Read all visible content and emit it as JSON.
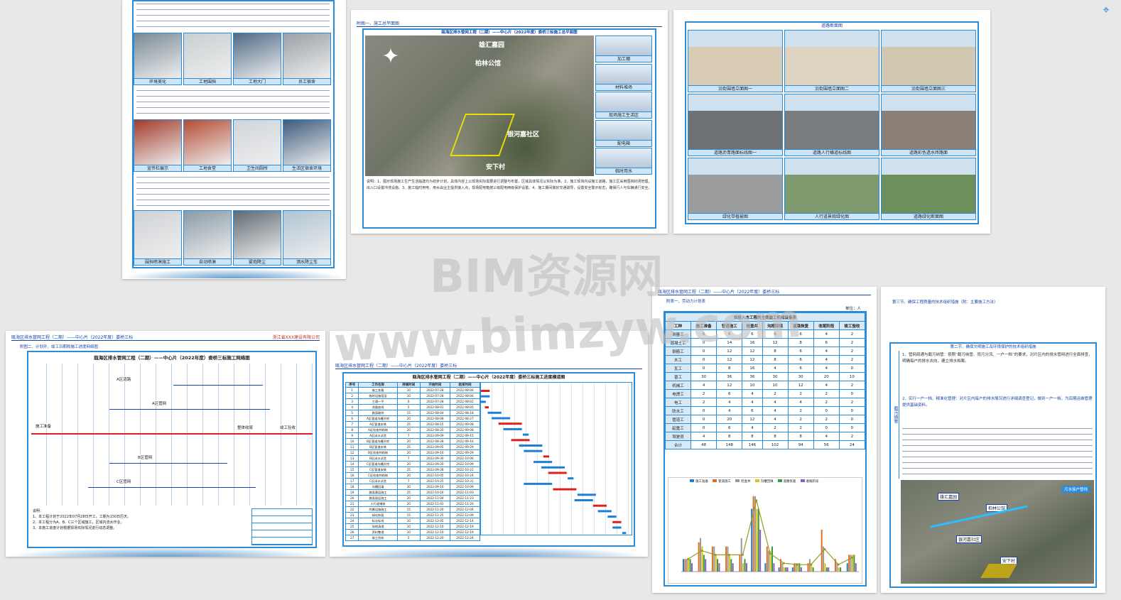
{
  "watermarks": [
    "BIM资源网",
    "www.bimzyw.com"
  ],
  "page1": {
    "photo_captions_row1": [
      "环境美化",
      "工地围挡",
      "工地大门",
      "员工宿舍"
    ],
    "photo_captions_row2": [
      "宣传栏展示",
      "工地食堂",
      "卫生间厕所",
      "生活区宿舍环境"
    ],
    "photo_captions_row3": [
      "围挡喷淋施工",
      "自动喷淋",
      "雾炮降尘",
      "洒水降尘车"
    ]
  },
  "page2": {
    "header": "附图一、施工总平面图",
    "title": "瓯海区排水管网工程（二期）——中心片（2022年度）娄桥三标施工总平面图",
    "map_labels": [
      "雄汇嘉园",
      "柏林公馆",
      "银河嘉社区",
      "安下村"
    ],
    "side_captions": [
      "加工棚",
      "材料堆场",
      "现场施工生活区",
      "配电箱",
      "临时用水"
    ],
    "note": "说明：1、图示现场施工生产生活临建均为初步计划，具体内容上以现场实际需要进行调整与布置，区域具体情况以实际为准。2、施工现场内设施工道路，施工区采用围挡封闭管理，出入口设置冲洗设施。3、施工临时用电、用水由业主提供接入点，现场配电箱按三级配电两级保护设置。4、施工期间做好交通疏导，设置安全警示标志，确保行人与车辆通行安全。"
  },
  "page3": {
    "title": "道路断面图",
    "captions_row1": [
      "沿街围墙立面图一",
      "沿街围墙立面图二",
      "沿街围墙立面图三"
    ],
    "captions_row2": [
      "道路沥青路面标线图一",
      "道路人行横道标线图",
      "道路彩色透水砖路面"
    ],
    "captions_row3": [
      "绿化带植被图",
      "人行道景观绿化图",
      "道路绿化断面图"
    ]
  },
  "page4": {
    "header_left": "瓯海区排水管网工程（二期）——中心片（2022年度）娄桥三标",
    "company": "浙江省XXX建设有限公司",
    "section": "附图二、计划开、竣工日期和施工进度网络图",
    "title": "瓯海区排水管网工程（二期）——中心片（2022年度）娄桥三标施工网络图",
    "labels": [
      "施工准备",
      "A区道路",
      "A区管网",
      "B区管网",
      "C区管网",
      "整体收尾",
      "竣工验收"
    ],
    "notes": [
      "说明：",
      "1、本工程计划于2022年07月28日开工，工期为150日历天。",
      "2、本工程分为A、B、C三个区域施工，区域内流水作业。",
      "3、本施工进度计划根据现场实际情况进行动态调整。"
    ]
  },
  "page5": {
    "header": "瓯海区排水管网工程（二期）——中心片（2022年度）娄桥三标",
    "title": "瓯海区排水管网工程（二期）——中心片（2022年度）娄桥三标施工进度横道图",
    "columns": [
      "序号",
      "工作名称",
      "持续时间",
      "开始时间",
      "结束时间"
    ],
    "rows": [
      [
        "1",
        "施工准备",
        "10",
        "2022-07-28",
        "2022-08-06"
      ],
      [
        "2",
        "临时设施搭设",
        "10",
        "2022-07-28",
        "2022-08-06"
      ],
      [
        "3",
        "三通一平",
        "6",
        "2022-07-28",
        "2022-08-02"
      ],
      [
        "4",
        "测量放线",
        "5",
        "2022-08-01",
        "2022-08-05"
      ],
      [
        "5",
        "路面破除",
        "15",
        "2022-08-04",
        "2022-08-18"
      ],
      [
        "6",
        "A区管道沟槽开挖",
        "20",
        "2022-08-08",
        "2022-08-27"
      ],
      [
        "7",
        "A区管道安装",
        "25",
        "2022-08-15",
        "2022-09-08"
      ],
      [
        "8",
        "A区检查井砌筑",
        "20",
        "2022-08-20",
        "2022-09-08"
      ],
      [
        "9",
        "A区闭水试验",
        "7",
        "2022-09-09",
        "2022-09-15"
      ],
      [
        "10",
        "B区管道沟槽开挖",
        "20",
        "2022-08-28",
        "2022-09-16"
      ],
      [
        "11",
        "B区管道安装",
        "25",
        "2022-09-05",
        "2022-09-29"
      ],
      [
        "12",
        "B区检查井砌筑",
        "20",
        "2022-09-10",
        "2022-09-29"
      ],
      [
        "13",
        "B区闭水试验",
        "7",
        "2022-09-30",
        "2022-10-06"
      ],
      [
        "14",
        "C区管道沟槽开挖",
        "20",
        "2022-09-20",
        "2022-10-09"
      ],
      [
        "15",
        "C区管道安装",
        "25",
        "2022-09-28",
        "2022-10-22"
      ],
      [
        "16",
        "C区检查井砌筑",
        "20",
        "2022-10-05",
        "2022-10-24"
      ],
      [
        "17",
        "C区闭水试验",
        "7",
        "2022-10-25",
        "2022-10-31"
      ],
      [
        "18",
        "沟槽回填",
        "30",
        "2022-09-10",
        "2022-10-09"
      ],
      [
        "19",
        "路面基层施工",
        "25",
        "2022-10-10",
        "2022-11-03"
      ],
      [
        "20",
        "路面面层施工",
        "20",
        "2022-11-04",
        "2022-11-23"
      ],
      [
        "21",
        "人行道铺装",
        "20",
        "2022-11-01",
        "2022-11-20"
      ],
      [
        "22",
        "附属设施施工",
        "15",
        "2022-11-20",
        "2022-12-04"
      ],
      [
        "23",
        "绿化恢复",
        "15",
        "2022-11-25",
        "2022-12-09"
      ],
      [
        "24",
        "标志标线",
        "10",
        "2022-12-05",
        "2022-12-14"
      ],
      [
        "25",
        "场地清理",
        "10",
        "2022-12-10",
        "2022-12-19"
      ],
      [
        "26",
        "资料整理",
        "10",
        "2022-12-10",
        "2022-12-19"
      ],
      [
        "27",
        "竣工验收",
        "5",
        "2022-12-20",
        "2022-12-24"
      ]
    ]
  },
  "page6": {
    "header": "瓯海区排水管网工程（二期）——中心片（2022年度）娄桥三标",
    "section": "附表一、劳动力计划表",
    "unit": "单位：人",
    "table_title": "拟投入本工程的主要施工机械设备表",
    "columns": [
      "工种",
      "施工准备",
      "管道施工",
      "检查井",
      "沟槽回填",
      "道路恢复",
      "收尾阶段",
      "竣工验收"
    ],
    "rows": [
      [
        "测量工",
        "6",
        "6",
        "6",
        "6",
        "6",
        "4",
        "2"
      ],
      [
        "混凝土工",
        "0",
        "14",
        "16",
        "12",
        "8",
        "6",
        "2"
      ],
      [
        "钢筋工",
        "0",
        "12",
        "12",
        "8",
        "6",
        "4",
        "2"
      ],
      [
        "木工",
        "0",
        "12",
        "12",
        "8",
        "6",
        "4",
        "2"
      ],
      [
        "瓦工",
        "0",
        "8",
        "16",
        "4",
        "6",
        "4",
        "0"
      ],
      [
        "普工",
        "30",
        "36",
        "36",
        "30",
        "30",
        "20",
        "10"
      ],
      [
        "机械工",
        "4",
        "12",
        "10",
        "10",
        "12",
        "4",
        "2"
      ],
      [
        "电焊工",
        "2",
        "6",
        "4",
        "2",
        "2",
        "2",
        "0"
      ],
      [
        "电工",
        "2",
        "4",
        "4",
        "4",
        "4",
        "2",
        "2"
      ],
      [
        "防水工",
        "0",
        "4",
        "6",
        "4",
        "2",
        "0",
        "0"
      ],
      [
        "管道工",
        "0",
        "20",
        "12",
        "4",
        "2",
        "2",
        "0"
      ],
      [
        "起重工",
        "0",
        "6",
        "4",
        "2",
        "2",
        "0",
        "0"
      ],
      [
        "驾驶员",
        "4",
        "8",
        "8",
        "8",
        "8",
        "4",
        "2"
      ],
      [
        "合计",
        "48",
        "148",
        "146",
        "102",
        "94",
        "56",
        "24"
      ]
    ],
    "legend": [
      "施工准备",
      "管道施工",
      "检查井",
      "沟槽回填",
      "道路恢复",
      "收尾阶段"
    ]
  },
  "page7": {
    "intro": "第三节、确保工程质量的技术组织措施（附：主要施工方法）",
    "section": "第二节、确保文明施工及环境保护的技术组织措施",
    "para1": "1、管网疏通与截污纳管：按照“截污纳管、雨污分流、一户一档”的要求，对片区内的排水管网进行全面排查，明确每户的排水去向，建立排水档案。",
    "para2": "2、实行一户一档、精准化管理：对片区内每户的排水情况进行详细调查登记，做到一户一档，为后期运维管理提供基础资料。",
    "map_labels": [
      "雄汇嘉园",
      "柏林公馆",
      "银河嘉社区",
      "安下村",
      "污水接户管线"
    ],
    "side_label": "截污纳管"
  }
}
